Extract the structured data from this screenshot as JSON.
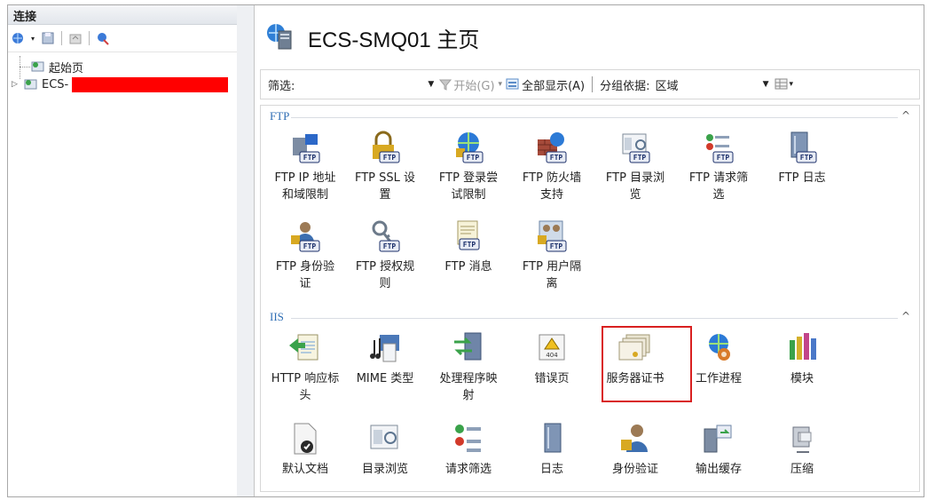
{
  "connections": {
    "title": "连接",
    "tree": [
      {
        "label": "起始页"
      },
      {
        "label": "ECS-"
      }
    ]
  },
  "page": {
    "title": "ECS-SMQ01 主页"
  },
  "filter": {
    "label": "筛选:",
    "start": "开始(G)",
    "show_all": "全部显示(A)",
    "group_by": "分组依据:",
    "group_value": "区域"
  },
  "sections": {
    "ftp": {
      "title": "FTP",
      "row1": [
        {
          "l1": "FTP IP 地址",
          "l2": "和域限制"
        },
        {
          "l1": "FTP SSL 设",
          "l2": "置"
        },
        {
          "l1": "FTP 登录尝",
          "l2": "试限制"
        },
        {
          "l1": "FTP 防火墙",
          "l2": "支持"
        },
        {
          "l1": "FTP 目录浏",
          "l2": "览"
        },
        {
          "l1": "FTP 请求筛",
          "l2": "选"
        },
        {
          "l1": "FTP 日志",
          "l2": ""
        }
      ],
      "row2": [
        {
          "l1": "FTP 身份验",
          "l2": "证"
        },
        {
          "l1": "FTP 授权规",
          "l2": "则"
        },
        {
          "l1": "FTP 消息",
          "l2": ""
        },
        {
          "l1": "FTP 用户隔",
          "l2": "离"
        }
      ]
    },
    "iis": {
      "title": "IIS",
      "row1": [
        {
          "l1": "HTTP 响应标",
          "l2": "头"
        },
        {
          "l1": "MIME 类型",
          "l2": ""
        },
        {
          "l1": "处理程序映",
          "l2": "射"
        },
        {
          "l1": "错误页",
          "l2": ""
        },
        {
          "l1": "服务器证书",
          "l2": ""
        },
        {
          "l1": "工作进程",
          "l2": ""
        },
        {
          "l1": "模块",
          "l2": ""
        }
      ],
      "row2": [
        {
          "l1": "默认文档",
          "l2": ""
        },
        {
          "l1": "目录浏览",
          "l2": ""
        },
        {
          "l1": "请求筛选",
          "l2": ""
        },
        {
          "l1": "日志",
          "l2": ""
        },
        {
          "l1": "身份验证",
          "l2": ""
        },
        {
          "l1": "输出缓存",
          "l2": ""
        },
        {
          "l1": "压缩",
          "l2": ""
        }
      ]
    }
  },
  "badges": {
    "ftp": "FTP",
    "error": "404"
  },
  "colors": {
    "accent": "#2e6db4",
    "highlight": "#d92020",
    "redaction": "#ff0000"
  }
}
